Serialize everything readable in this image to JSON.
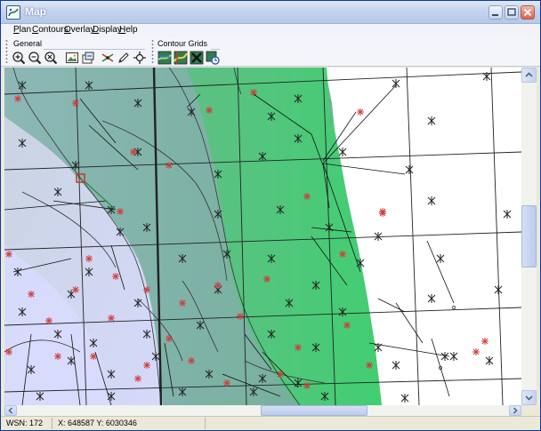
{
  "window": {
    "title": "Map",
    "icons": {
      "app": "map-app-icon",
      "minimize": "minimize-icon",
      "maximize": "maximize-icon",
      "close": "close-icon"
    }
  },
  "menu": [
    {
      "label": "Plan",
      "accel": "P"
    },
    {
      "label": "Contours",
      "accel": "C"
    },
    {
      "label": "Overlay",
      "accel": "O"
    },
    {
      "label": "Display",
      "accel": "D"
    },
    {
      "label": "Help",
      "accel": "H"
    }
  ],
  "toolbars": {
    "general": {
      "title": "General",
      "buttons": [
        "zoom-in-icon",
        "zoom-out-icon",
        "zoom-extent-icon",
        "image-icon",
        "export-icon",
        "well-link-icon",
        "pen-icon",
        "crosshair-icon"
      ]
    },
    "contour_grids": {
      "title": "Contour Grids",
      "buttons": [
        "grid-color-icon",
        "grid-shade-icon",
        "grid-x-icon",
        "grid-refresh-icon"
      ]
    }
  },
  "status": {
    "wsn_label": "WSN: 172",
    "coords": "X: 648587  Y: 6030346"
  },
  "colors": {
    "accent": "#2d5cb8",
    "map_lavender": "#cdd3f2",
    "map_teal": "#7fb5a2",
    "map_green": "#4dc87a",
    "marker_red": "#d23a3a"
  }
}
